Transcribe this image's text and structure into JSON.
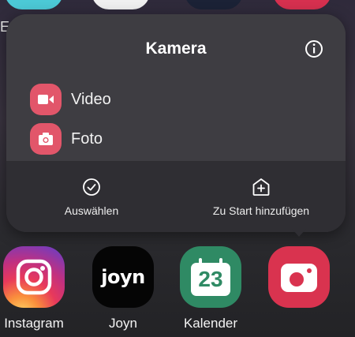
{
  "popup": {
    "title": "Kamera",
    "shortcuts": [
      {
        "label": "Video",
        "icon": "video-camera-icon"
      },
      {
        "label": "Foto",
        "icon": "camera-icon"
      }
    ],
    "actions": [
      {
        "label": "Auswählen",
        "icon": "check-circle-icon"
      },
      {
        "label": "Zu Start hinzufügen",
        "icon": "plus-square-icon"
      }
    ]
  },
  "background": {
    "left_letter": "E"
  },
  "dock": {
    "apps": [
      {
        "label": "Instagram",
        "icon": "instagram-icon"
      },
      {
        "label": "Joyn",
        "icon": "joyn-icon",
        "icon_text": "joyn"
      },
      {
        "label": "Kalender",
        "icon": "calendar-icon",
        "icon_text": "23"
      },
      {
        "label": "",
        "icon": "camera-app-icon"
      }
    ]
  },
  "colors": {
    "accent": "#e2566a",
    "calendar": "#2f8a64",
    "camera": "#d9334f"
  }
}
